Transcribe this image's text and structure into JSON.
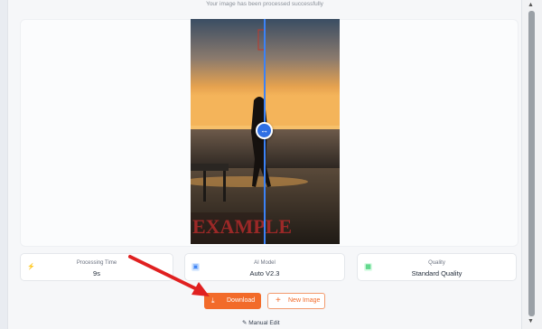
{
  "status_text": "Your image has been processed successfully",
  "preview": {
    "watermark": "EXAMPLE",
    "slider_icon": "arrows-horizontal-icon"
  },
  "cards": [
    {
      "label": "Processing Time",
      "value": "9s",
      "icon": "lightning-icon",
      "color": "#f5a623"
    },
    {
      "label": "AI Model",
      "value": "Auto V2.3",
      "icon": "chip-icon",
      "color": "#3b82f6"
    },
    {
      "label": "Quality",
      "value": "Standard Quality",
      "icon": "image-icon",
      "color": "#22c55e"
    }
  ],
  "buttons": {
    "download": "Download",
    "new_image": "New Image",
    "manual_edit": "Manual Edit"
  },
  "accent": "#f26b2a",
  "annotation_arrow_color": "#e02020"
}
